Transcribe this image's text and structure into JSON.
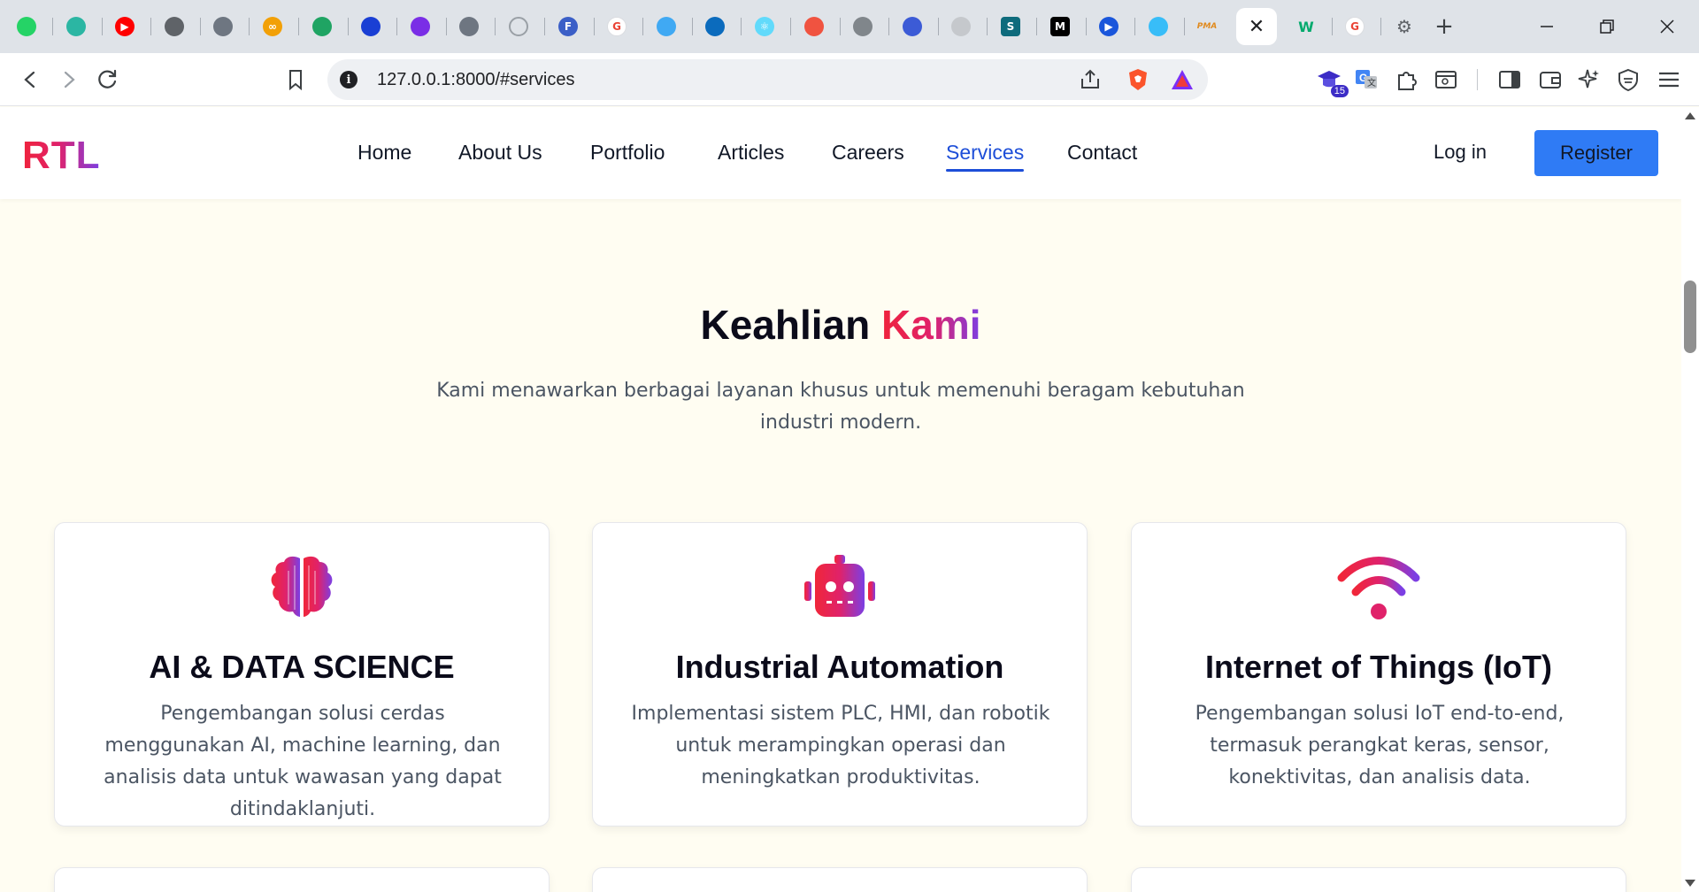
{
  "browser": {
    "tabs": [
      {
        "icon": "whatsapp-icon",
        "color": "#25d366",
        "glyph": ""
      },
      {
        "icon": "wifi-shield-icon",
        "color": "#2bb6a3",
        "glyph": ""
      },
      {
        "icon": "youtube-icon",
        "color": "#ff0000",
        "glyph": "▶"
      },
      {
        "icon": "bug-icon",
        "color": "#5f6368",
        "glyph": ""
      },
      {
        "icon": "github-icon",
        "color": "#6e7681",
        "glyph": ""
      },
      {
        "icon": "coursera-icon",
        "color": "#f2a007",
        "glyph": "∞"
      },
      {
        "icon": "google-drive-icon",
        "color": "#1fa463",
        "glyph": ""
      },
      {
        "icon": "butterfly-icon",
        "color": "#1a3fd4",
        "glyph": ""
      },
      {
        "icon": "pen-circle-icon",
        "color": "#7a2ee6",
        "glyph": ""
      },
      {
        "icon": "github-icon",
        "color": "#6e7681",
        "glyph": ""
      },
      {
        "icon": "loading-circle-icon",
        "color": "#9aa0a6",
        "glyph": ""
      },
      {
        "icon": "fiverr-circle-icon",
        "color": "#3b5fc7",
        "glyph": "F"
      },
      {
        "icon": "google-icon",
        "color": "#ea4335",
        "glyph": "G"
      },
      {
        "icon": "flutter-icon",
        "color": "#40a9f3",
        "glyph": ""
      },
      {
        "icon": "cube-icon",
        "color": "#0b6bbd",
        "glyph": ""
      },
      {
        "icon": "react-icon",
        "color": "#61dafb",
        "glyph": "⚛"
      },
      {
        "icon": "laravel-icon",
        "color": "#f05340",
        "glyph": ""
      },
      {
        "icon": "globe-icon",
        "color": "#80868b",
        "glyph": ""
      },
      {
        "icon": "bird-icon",
        "color": "#3c5bd6",
        "glyph": ""
      },
      {
        "icon": "openai-icon",
        "color": "#c5c8cc",
        "glyph": ""
      },
      {
        "icon": "s-square-icon",
        "color": "#0e6b7c",
        "glyph": "S"
      },
      {
        "icon": "medium-icon",
        "color": "#000000",
        "glyph": "M"
      },
      {
        "icon": "play-circle-icon",
        "color": "#1a56db",
        "glyph": "▶"
      },
      {
        "icon": "tailwind-icon",
        "color": "#38bdf8",
        "glyph": ""
      },
      {
        "icon": "phpmyadmin-icon",
        "color": "#e08a1e",
        "glyph": "PMA"
      },
      {
        "icon": "close-icon",
        "color": "#202124",
        "glyph": "✕",
        "active": true
      },
      {
        "icon": "w3-icon",
        "color": "#04aa6d",
        "glyph": "W"
      },
      {
        "icon": "google-icon",
        "color": "#ea4335",
        "glyph": "G"
      },
      {
        "icon": "settings-gear-icon",
        "color": "#5f6368",
        "glyph": "⚙"
      }
    ],
    "url": "127.0.0.1:8000/#services",
    "extension_badge": "15"
  },
  "site": {
    "logo": "RTL",
    "nav": [
      "Home",
      "About Us",
      "Portfolio",
      "Articles",
      "Careers",
      "Services",
      "Contact"
    ],
    "active_nav": "Services",
    "login": "Log in",
    "register": "Register",
    "accent_blue": "#2f7bf5"
  },
  "services": {
    "title_main": "Keahlian",
    "title_accent": "Kami",
    "subtitle": "Kami menawarkan berbagai layanan khusus untuk memenuhi beragam kebutuhan industri modern.",
    "cards": [
      {
        "icon": "brain-icon",
        "title": "AI & DATA SCIENCE",
        "description": "Pengembangan solusi cerdas menggunakan AI, machine learning, dan analisis data untuk wawasan yang dapat ditindaklanjuti."
      },
      {
        "icon": "robot-icon",
        "title": "Industrial Automation",
        "description": "Implementasi sistem PLC, HMI, dan robotik untuk merampingkan operasi dan meningkatkan produktivitas."
      },
      {
        "icon": "wifi-icon",
        "title": "Internet of Things (IoT)",
        "description": "Pengembangan solusi IoT end-to-end, termasuk perangkat keras, sensor, konektivitas, dan analisis data."
      }
    ]
  }
}
